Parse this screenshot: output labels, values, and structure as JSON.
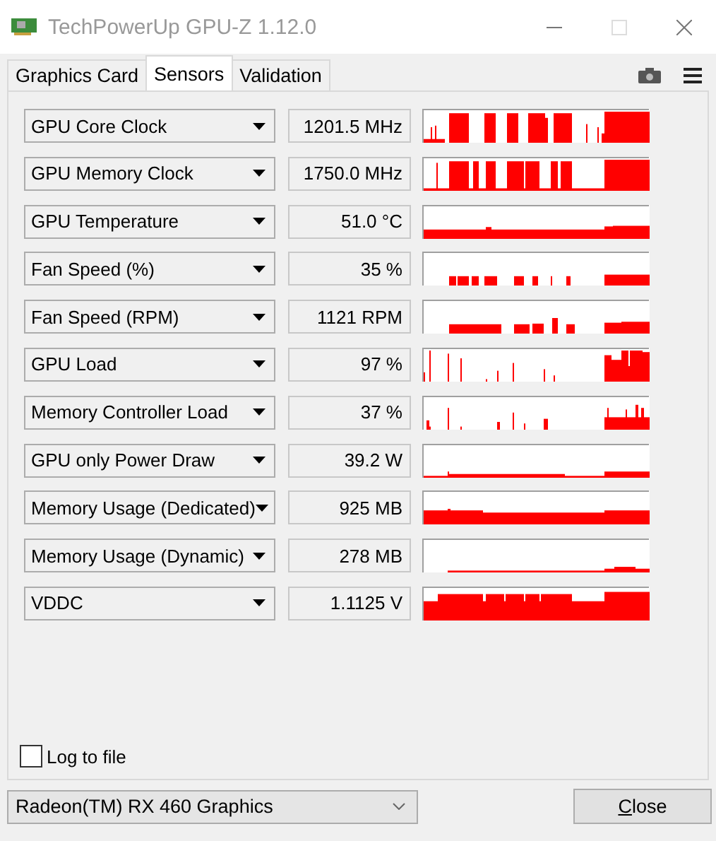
{
  "window": {
    "title": "TechPowerUp GPU-Z 1.12.0"
  },
  "tabs": [
    {
      "label": "Graphics Card",
      "selected": false
    },
    {
      "label": "Sensors",
      "selected": true
    },
    {
      "label": "Validation",
      "selected": false
    }
  ],
  "sensors": [
    {
      "name": "GPU Core Clock",
      "value": "1201.5 MHz"
    },
    {
      "name": "GPU Memory Clock",
      "value": "1750.0 MHz"
    },
    {
      "name": "GPU Temperature",
      "value": "51.0 °C"
    },
    {
      "name": "Fan Speed (%)",
      "value": "35 %"
    },
    {
      "name": "Fan Speed (RPM)",
      "value": "1121 RPM"
    },
    {
      "name": "GPU Load",
      "value": "97 %"
    },
    {
      "name": "Memory Controller Load",
      "value": "37 %"
    },
    {
      "name": "GPU only Power Draw",
      "value": "39.2 W"
    },
    {
      "name": "Memory Usage (Dedicated)",
      "value": "925 MB"
    },
    {
      "name": "Memory Usage (Dynamic)",
      "value": "278 MB"
    },
    {
      "name": "VDDC",
      "value": "1.1125 V"
    }
  ],
  "log_to_file": {
    "label": "Log to file",
    "checked": false
  },
  "gpu_select": {
    "value": "Radeon(TM) RX 460 Graphics"
  },
  "buttons": [
    {
      "label": "Close"
    }
  ]
}
